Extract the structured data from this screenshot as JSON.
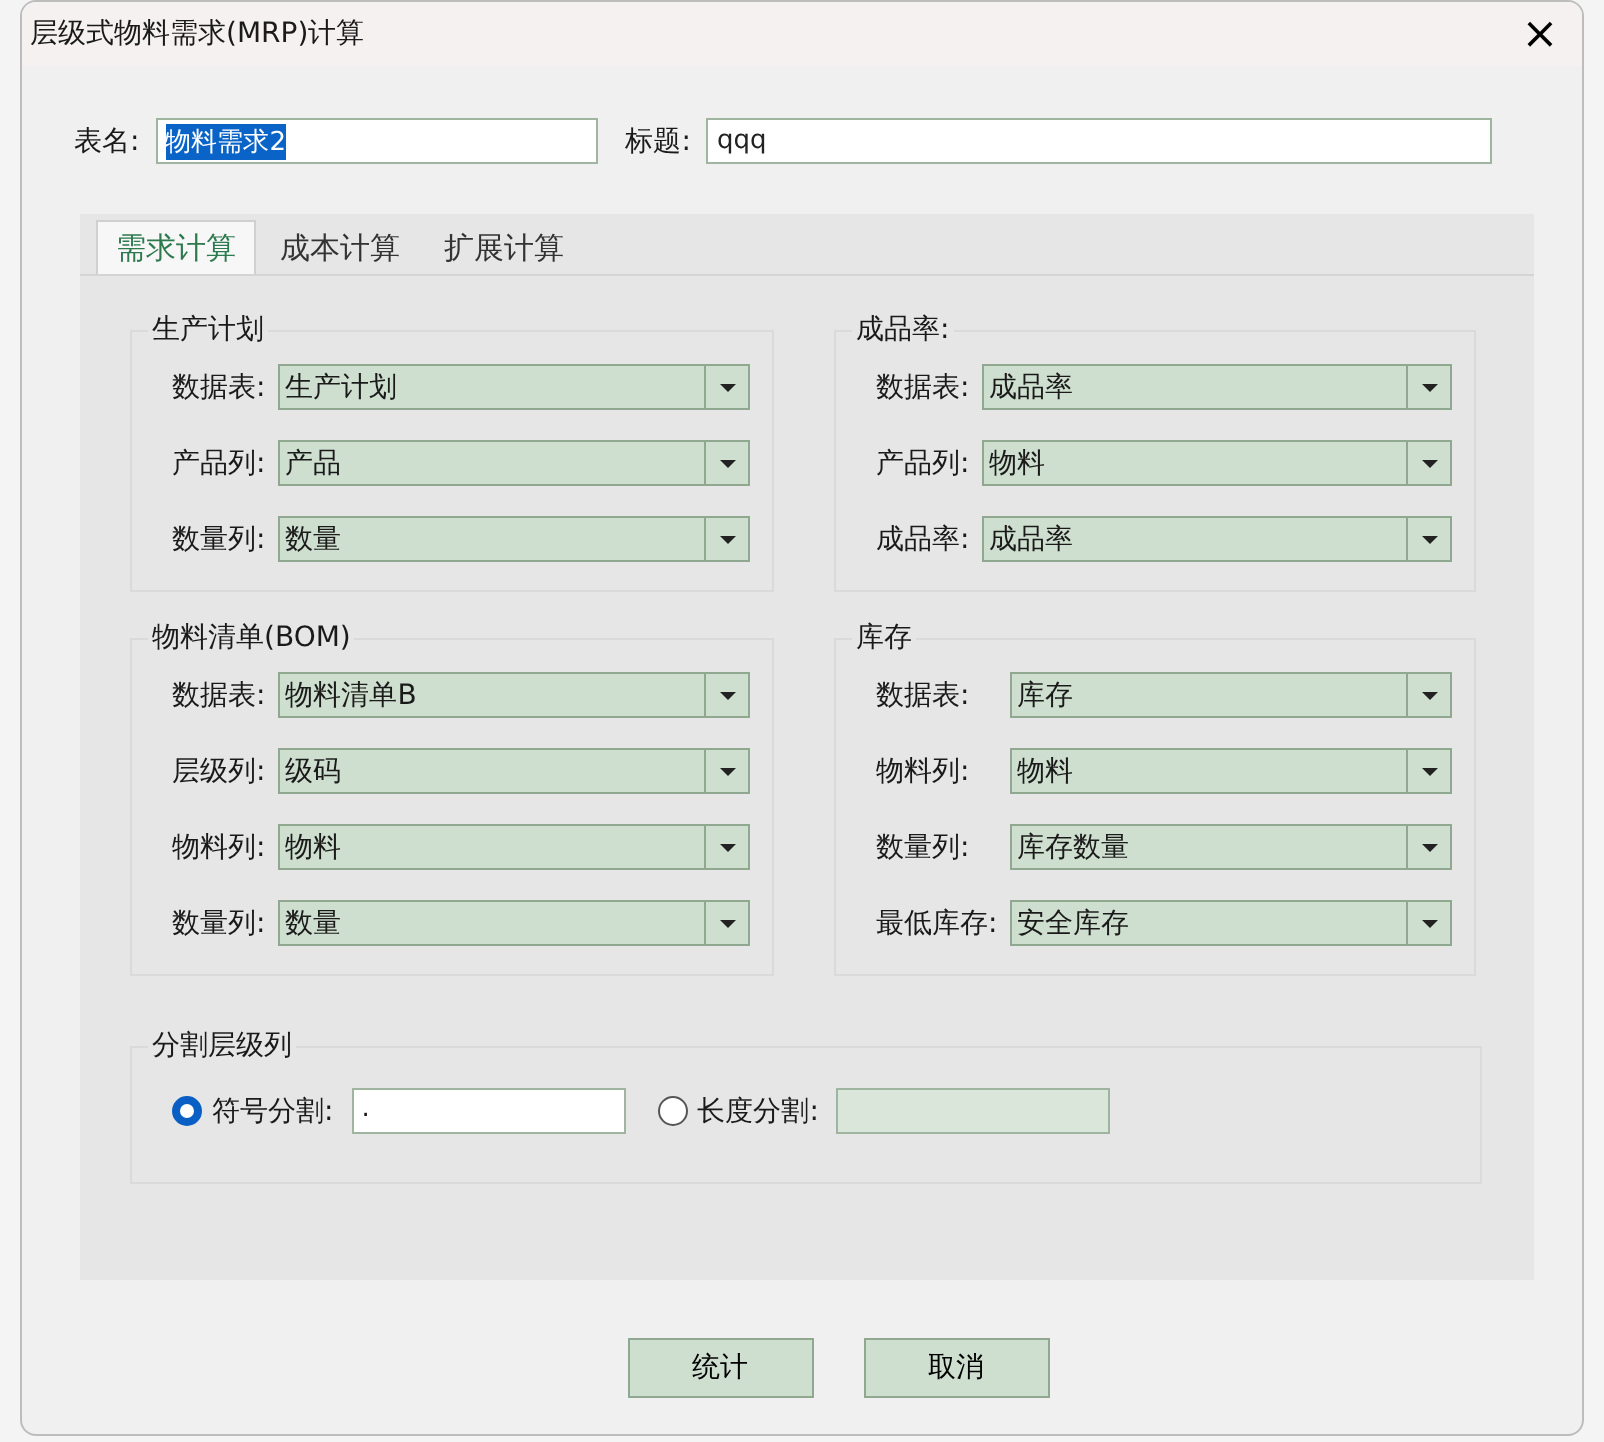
{
  "window": {
    "title": "层级式物料需求(MRP)计算",
    "close": "×"
  },
  "header": [
    {
      "label": "表名:",
      "value": "物料需求2",
      "text_selected": true
    },
    {
      "label": "标题:",
      "value": "qqq",
      "text_selected": false
    }
  ],
  "tabs": [
    {
      "label": "需求计算",
      "selected": true
    },
    {
      "label": "成本计算",
      "selected": false
    },
    {
      "label": "扩展计算",
      "selected": false
    }
  ],
  "groups": [
    {
      "title": "生产计划",
      "fields": [
        {
          "label": "数据表:",
          "value": "生产计划"
        },
        {
          "label": "产品列:",
          "value": "产品"
        },
        {
          "label": "数量列:",
          "value": "数量"
        }
      ]
    },
    {
      "title": "成品率:",
      "fields": [
        {
          "label": "数据表:",
          "value": "成品率"
        },
        {
          "label": "产品列:",
          "value": "物料"
        },
        {
          "label": "成品率:",
          "value": "成品率"
        }
      ]
    },
    {
      "title": "物料清单(BOM)",
      "fields": [
        {
          "label": "数据表:",
          "value": "物料清单B"
        },
        {
          "label": "层级列:",
          "value": "级码"
        },
        {
          "label": "物料列:",
          "value": "物料"
        },
        {
          "label": "数量列:",
          "value": "数量"
        }
      ]
    },
    {
      "title": "库存",
      "fields": [
        {
          "label": "数据表:",
          "value": "库存"
        },
        {
          "label": "物料列:",
          "value": "物料"
        },
        {
          "label": "数量列:",
          "value": "库存数量"
        },
        {
          "label": "最低库存:",
          "value": "安全库存"
        }
      ]
    }
  ],
  "split": {
    "title": "分割层级列",
    "options": [
      {
        "label": "符号分割:",
        "selected": true,
        "value": ".",
        "disabled": false
      },
      {
        "label": "长度分割:",
        "selected": false,
        "disabled": true
      }
    ]
  },
  "buttons": [
    "统计",
    "取消"
  ]
}
